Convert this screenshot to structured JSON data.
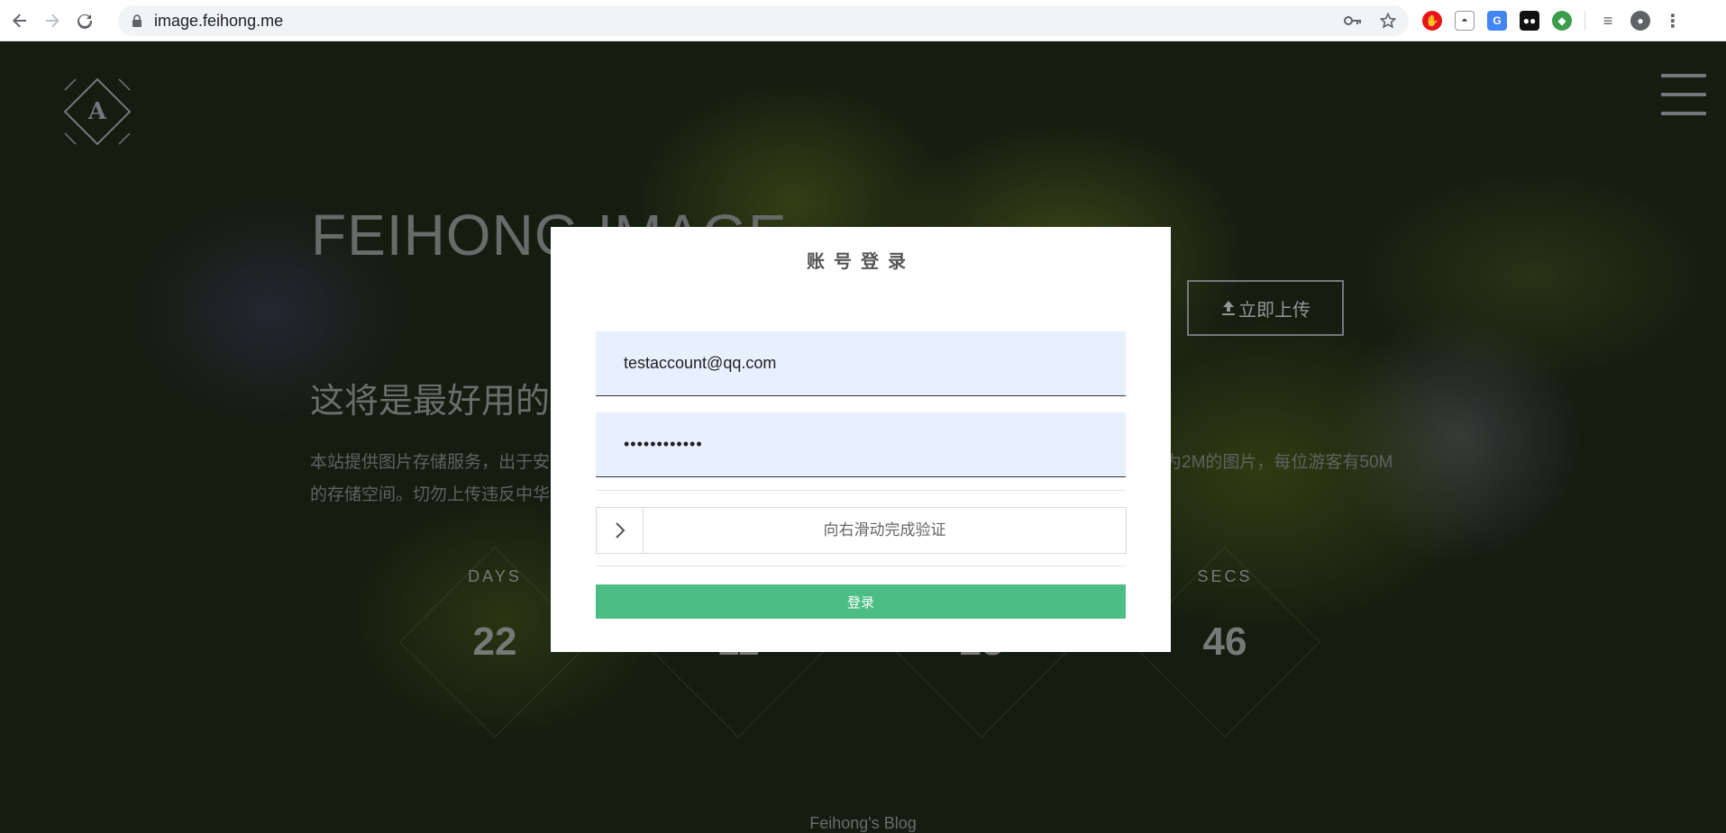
{
  "browser": {
    "url": "image.feihong.me",
    "extensions": [
      "adblock-icon",
      "incognito-ext-icon",
      "translate-icon",
      "tampermonkey-icon",
      "extension-icon",
      "reading-list-icon",
      "profile-icon",
      "menu-icon"
    ]
  },
  "site": {
    "title": "FEIHONG IMAGE",
    "upload_label": "立即上传",
    "subtitle": "这将是最好用的",
    "desc_line1": "本站提供图片存储服务，出于安",
    "desc_line1_right": "为2M的图片，每位游客有50M",
    "desc_line2": "的存储空间。切勿上传违反中华",
    "countdown": [
      {
        "label": "DAYS",
        "value": "22"
      },
      {
        "label": "",
        "value": "11"
      },
      {
        "label": "",
        "value": "23"
      },
      {
        "label": "SECS",
        "value": "46"
      }
    ],
    "footer": "Feihong's Blog"
  },
  "login": {
    "title": "账号登录",
    "email_value": "testaccount@qq.com",
    "password_value": "••••••••••••",
    "slider_text": "向右滑动完成验证",
    "submit_label": "登录"
  },
  "colors": {
    "accent": "#4bbd85",
    "field_bg": "#e8f0fe"
  }
}
